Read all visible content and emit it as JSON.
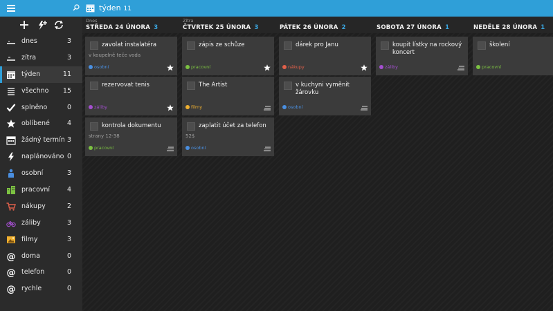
{
  "header": {
    "title": "týden",
    "count": "11"
  },
  "sidebar": {
    "items": [
      {
        "id": "dnes",
        "label": "dnes",
        "count": "3",
        "icon": "today-icon"
      },
      {
        "id": "zitra",
        "label": "zítra",
        "count": "3",
        "icon": "tomorrow-icon"
      },
      {
        "id": "tyden",
        "label": "týden",
        "count": "11",
        "icon": "calendar-icon"
      },
      {
        "id": "vsechno",
        "label": "všechno",
        "count": "15",
        "icon": "list-icon"
      },
      {
        "id": "splneno",
        "label": "splněno",
        "count": "0",
        "icon": "check-icon"
      },
      {
        "id": "oblibene",
        "label": "oblíbené",
        "count": "4",
        "icon": "star-icon"
      },
      {
        "id": "zadny-termin",
        "label": "žádný termín",
        "count": "3",
        "icon": "no-date-icon"
      },
      {
        "id": "naplanovano",
        "label": "naplánováno",
        "count": "0",
        "icon": "lightning-icon"
      },
      {
        "id": "osobni",
        "label": "osobní",
        "count": "3",
        "icon": "person-icon"
      },
      {
        "id": "pracovni",
        "label": "pracovní",
        "count": "4",
        "icon": "building-icon"
      },
      {
        "id": "nakupy",
        "label": "nákupy",
        "count": "2",
        "icon": "cart-icon"
      },
      {
        "id": "zaliby",
        "label": "záliby",
        "count": "3",
        "icon": "bicycle-icon"
      },
      {
        "id": "filmy",
        "label": "filmy",
        "count": "3",
        "icon": "image-icon"
      },
      {
        "id": "doma",
        "label": "doma",
        "count": "0",
        "icon": "at-icon"
      },
      {
        "id": "telefon",
        "label": "telefon",
        "count": "0",
        "icon": "at-icon"
      },
      {
        "id": "rychle",
        "label": "rychle",
        "count": "0",
        "icon": "at-icon"
      }
    ]
  },
  "colors": {
    "accent": "#2f9fd8",
    "osobni": "#4a8fe0",
    "pracovni": "#7cc242",
    "nakupy": "#e0604a",
    "zaliby": "#a44fd0",
    "filmy": "#f0b030"
  },
  "columns": [
    {
      "sub": "Dnes",
      "day": "STŘEDA 24 ÚNORA",
      "count": "3",
      "cards": [
        {
          "title": "zavolat instalatéra",
          "note": "v koupelně teče voda",
          "category": "osobní",
          "cat_key": "osobni",
          "flag": "star"
        },
        {
          "title": "rezervovat tenis",
          "note": "",
          "category": "záliby",
          "cat_key": "zaliby",
          "flag": "star"
        },
        {
          "title": "kontrola dokumentu",
          "note": "strany 12-38",
          "category": "pracovní",
          "cat_key": "pracovni",
          "flag": "lines"
        }
      ]
    },
    {
      "sub": "Zítra",
      "day": "ČTVRTEK 25 ÚNORA",
      "count": "3",
      "cards": [
        {
          "title": "zápis ze schůze",
          "note": "",
          "category": "pracovní",
          "cat_key": "pracovni",
          "flag": "star"
        },
        {
          "title": "The Artist",
          "note": "",
          "category": "filmy",
          "cat_key": "filmy",
          "flag": "lines"
        },
        {
          "title": "zaplatit účet za telefon",
          "note": "52$",
          "category": "osobní",
          "cat_key": "osobni",
          "flag": "lines"
        }
      ]
    },
    {
      "sub": "",
      "day": "PÁTEK 26 ÚNORA",
      "count": "2",
      "cards": [
        {
          "title": "dárek pro Janu",
          "note": "",
          "category": "nákupy",
          "cat_key": "nakupy",
          "flag": "star"
        },
        {
          "title": "v kuchyni vyměnit žárovku",
          "note": "",
          "category": "osobní",
          "cat_key": "osobni",
          "flag": "lines"
        }
      ]
    },
    {
      "sub": "",
      "day": "SOBOTA 27 ÚNORA",
      "count": "1",
      "cards": [
        {
          "title": "koupit lístky na rockový koncert",
          "note": "",
          "category": "záliby",
          "cat_key": "zaliby",
          "flag": "lines"
        }
      ]
    },
    {
      "sub": "",
      "day": "NEDĚLE 28 ÚNORA",
      "count": "1",
      "cards": [
        {
          "title": "školení",
          "note": "",
          "category": "pracovní",
          "cat_key": "pracovni",
          "flag": "lines"
        }
      ]
    }
  ]
}
